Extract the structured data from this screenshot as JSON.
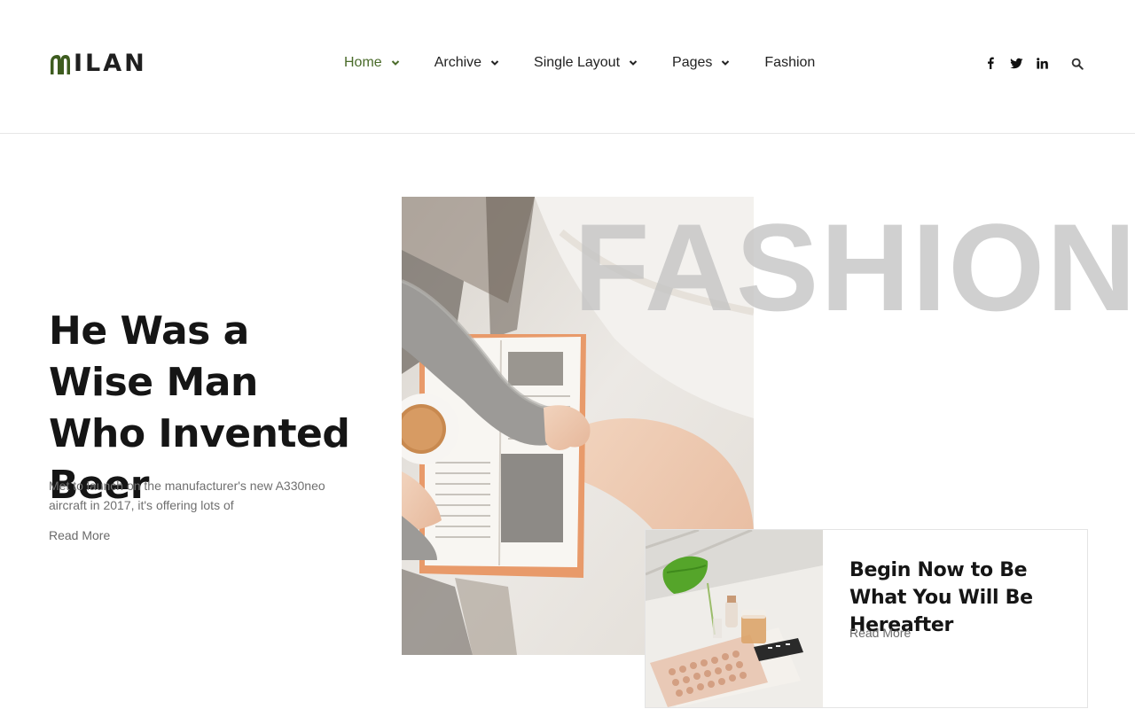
{
  "brand": {
    "name": "ILAN",
    "accent_color": "#3e5c1f"
  },
  "nav": {
    "items": [
      {
        "label": "Home",
        "has_dropdown": true,
        "active": true
      },
      {
        "label": "Archive",
        "has_dropdown": true,
        "active": false
      },
      {
        "label": "Single Layout",
        "has_dropdown": true,
        "active": false
      },
      {
        "label": "Pages",
        "has_dropdown": true,
        "active": false
      },
      {
        "label": "Fashion",
        "has_dropdown": false,
        "active": false
      }
    ],
    "active_color": "#4a6b2a"
  },
  "social": {
    "icons": [
      "facebook-icon",
      "twitter-icon",
      "linkedin-icon"
    ],
    "search_icon": "search-icon"
  },
  "hero": {
    "title": "He Was a Wise Man Who Invented Beer",
    "excerpt": "Met to launch on the manufacturer's new A330neo aircraft in 2017, it's offering lots of",
    "read_more": "Read More",
    "category_word": "FASHION"
  },
  "card": {
    "title": "Begin Now to Be What You Will Be Hereafter",
    "read_more": "Read More"
  }
}
